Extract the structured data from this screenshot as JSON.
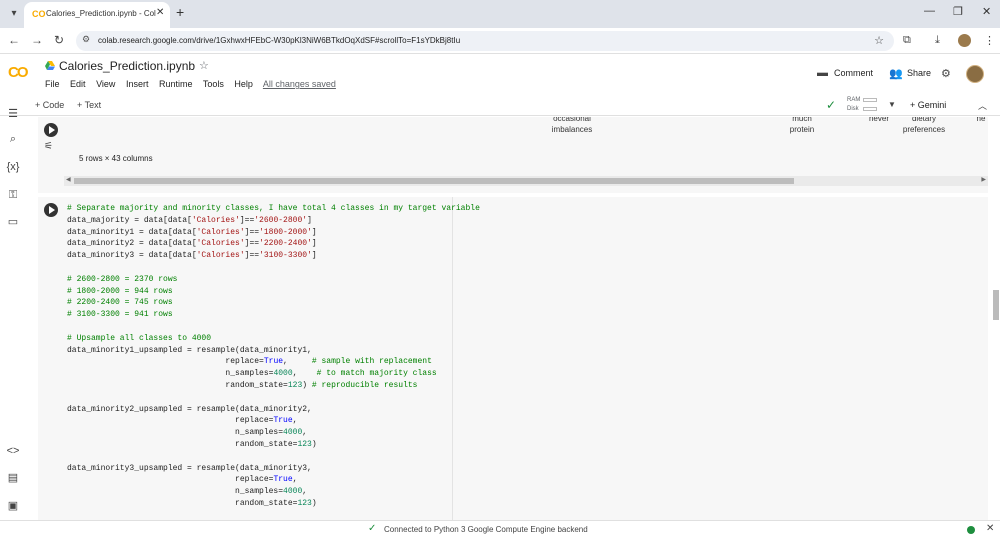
{
  "browser": {
    "tab_title": "Calories_Prediction.ipynb - Cola",
    "url": "colab.research.google.com/drive/1GxhwxHFEbC-W30pKl3NiW6BTkdOqXdSF#scrollTo=F1sYDkBj8tIu"
  },
  "colab": {
    "logo": "CO",
    "title": "Calories_Prediction.ipynb",
    "menu": [
      "File",
      "Edit",
      "View",
      "Insert",
      "Runtime",
      "Tools",
      "Help"
    ],
    "saved_status": "All changes saved",
    "comment_label": "Comment",
    "share_label": "Share"
  },
  "toolbar": {
    "code_label": "+ Code",
    "text_label": "+ Text",
    "ram_label": "RAM",
    "disk_label": "Disk",
    "gemini_label": "+ Gemini"
  },
  "output_cell": {
    "columns": [
      {
        "text": "occasional\nimbalances"
      },
      {
        "text": "much\nprotein"
      },
      {
        "text": "never"
      },
      {
        "text": "dietary\npreferences"
      },
      {
        "text": "ne"
      }
    ],
    "rows_note": "5 rows × 43 columns"
  },
  "code_cell": {
    "lines": [
      [
        {
          "t": "# Separate majority and minority classes, I have total 4 classes in my target variable",
          "c": "cm"
        }
      ],
      [
        {
          "t": "data_majority = data[data["
        },
        {
          "t": "'Calories'",
          "c": "st"
        },
        {
          "t": "]=="
        },
        {
          "t": "'2600-2800'",
          "c": "st"
        },
        {
          "t": "]"
        }
      ],
      [
        {
          "t": "data_minority1 = data[data["
        },
        {
          "t": "'Calories'",
          "c": "st"
        },
        {
          "t": "]=="
        },
        {
          "t": "'1800-2000'",
          "c": "st"
        },
        {
          "t": "]"
        }
      ],
      [
        {
          "t": "data_minority2 = data[data["
        },
        {
          "t": "'Calories'",
          "c": "st"
        },
        {
          "t": "]=="
        },
        {
          "t": "'2200-2400'",
          "c": "st"
        },
        {
          "t": "]"
        }
      ],
      [
        {
          "t": "data_minority3 = data[data["
        },
        {
          "t": "'Calories'",
          "c": "st"
        },
        {
          "t": "]=="
        },
        {
          "t": "'3100-3300'",
          "c": "st"
        },
        {
          "t": "]"
        }
      ],
      [],
      [
        {
          "t": "# 2600-2800 = 2370 rows",
          "c": "cm"
        }
      ],
      [
        {
          "t": "# 1800-2000 = 944 rows",
          "c": "cm"
        }
      ],
      [
        {
          "t": "# 2200-2400 = 745 rows",
          "c": "cm"
        }
      ],
      [
        {
          "t": "# 3100-3300 = 941 rows",
          "c": "cm"
        }
      ],
      [],
      [
        {
          "t": "# Upsample all classes to 4000",
          "c": "cm"
        }
      ],
      [
        {
          "t": "data_minority1_upsampled = resample(data_minority1,"
        }
      ],
      [
        {
          "t": "                                 replace="
        },
        {
          "t": "True",
          "c": "kw"
        },
        {
          "t": ",     "
        },
        {
          "t": "# sample with replacement",
          "c": "cm"
        }
      ],
      [
        {
          "t": "                                 n_samples="
        },
        {
          "t": "4000",
          "c": "nm"
        },
        {
          "t": ",    "
        },
        {
          "t": "# to match majority class",
          "c": "cm"
        }
      ],
      [
        {
          "t": "                                 random_state="
        },
        {
          "t": "123",
          "c": "nm"
        },
        {
          "t": ") "
        },
        {
          "t": "# reproducible results",
          "c": "cm"
        }
      ],
      [],
      [
        {
          "t": "data_minority2_upsampled = resample(data_minority2,"
        }
      ],
      [
        {
          "t": "                                   replace="
        },
        {
          "t": "True",
          "c": "kw"
        },
        {
          "t": ","
        }
      ],
      [
        {
          "t": "                                   n_samples="
        },
        {
          "t": "4000",
          "c": "nm"
        },
        {
          "t": ","
        }
      ],
      [
        {
          "t": "                                   random_state="
        },
        {
          "t": "123",
          "c": "nm"
        },
        {
          "t": ")"
        }
      ],
      [],
      [
        {
          "t": "data_minority3_upsampled = resample(data_minority3,"
        }
      ],
      [
        {
          "t": "                                   replace="
        },
        {
          "t": "True",
          "c": "kw"
        },
        {
          "t": ","
        }
      ],
      [
        {
          "t": "                                   n_samples="
        },
        {
          "t": "4000",
          "c": "nm"
        },
        {
          "t": ","
        }
      ],
      [
        {
          "t": "                                   random_state="
        },
        {
          "t": "123",
          "c": "nm"
        },
        {
          "t": ")"
        }
      ]
    ]
  },
  "status": {
    "text": "Connected to Python 3 Google Compute Engine backend"
  },
  "icons": [
    "tab-list-icon",
    "colab-favicon",
    "close-icon",
    "new-tab-icon",
    "minimize-icon",
    "restore-icon",
    "back-icon",
    "forward-icon",
    "reload-icon",
    "site-info-icon",
    "bookmark-star-icon",
    "extensions-icon",
    "download-icon",
    "profile-icon",
    "kebab-menu-icon",
    "drive-icon",
    "star-icon",
    "comment-icon",
    "share-icon",
    "settings-gear-icon",
    "toc-icon",
    "search-icon",
    "variables-icon",
    "key-icon",
    "folder-icon",
    "code-snippets-icon",
    "command-palette-icon",
    "terminal-icon",
    "run-icon",
    "output-options-icon",
    "check-icon",
    "chevron-down-icon",
    "chevron-up-icon"
  ]
}
